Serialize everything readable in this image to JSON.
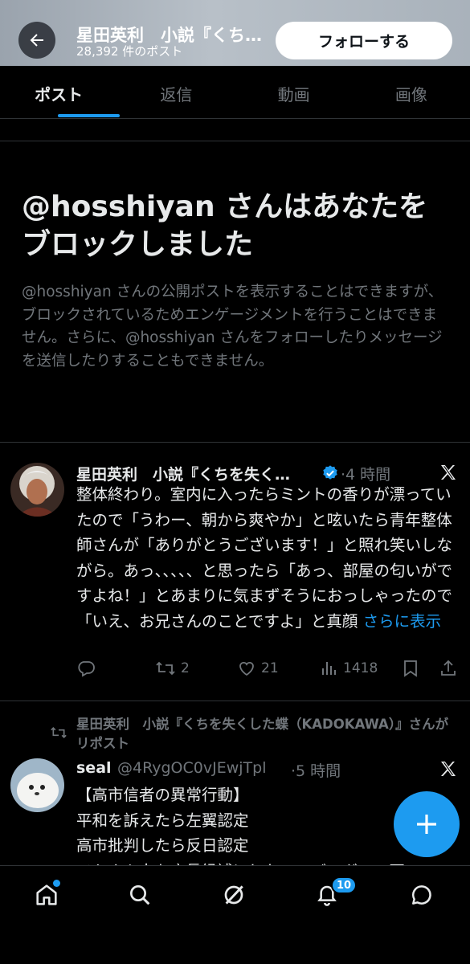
{
  "header": {
    "title": "星田英利　小説『くちを失くした蝶（KADOKAWA）』",
    "post_count": "28,392 件のポスト",
    "follow_label": "フォローする"
  },
  "tabs": [
    {
      "label": "ポスト",
      "active": true
    },
    {
      "label": "返信",
      "active": false
    },
    {
      "label": "動画",
      "active": false
    },
    {
      "label": "画像",
      "active": false
    }
  ],
  "blocked_notice": {
    "title": "@hosshiyan さんはあなたをブロックしました",
    "body": "@hosshiyan さんの公開ポストを表示することはできますが、ブロックされているためエンゲージメントを行うことはできません。さらに、@hosshiyan さんをフォローしたりメッセージを送信したりすることもできません。"
  },
  "tweet1": {
    "display_name": "星田英利　小説『くちを失く…",
    "verified": true,
    "time": "·4 時間",
    "body": "整体終わり。室内に入ったらミントの香りが漂っていたので「うわー、朝から爽やか」と呟いたら青年整体師さんが「ありがとうございます！」と照れ笑いしながら。あっ、、、、、と思ったら「あっ、部屋の匂いがですよね！」とあまりに気まずそうにおっしゃったので「いえ、お兄さんのことですよ」と真顔",
    "show_more": "さらに表示",
    "retweets": "2",
    "likes": "21",
    "views": "1418"
  },
  "repost_line": "星田英利　小説『くちを失くした蝶（KADOKAWA）』さんがリポスト",
  "tweet2": {
    "display_name": "seal",
    "handle": "@4RygOC0vJEwjTpl",
    "time": "·5 時間",
    "lines": [
      "【高市信者の異常行動】",
      "平和を訴えたら左翼認定",
      "高市批判したら反日認定",
      "ベトナム人を店長候補にしたモスバーガーの不"
    ]
  },
  "nav": {
    "notification_count": "10"
  },
  "colors": {
    "accent": "#1d9bf0",
    "background": "#000000",
    "secondary_text": "#71767b"
  }
}
